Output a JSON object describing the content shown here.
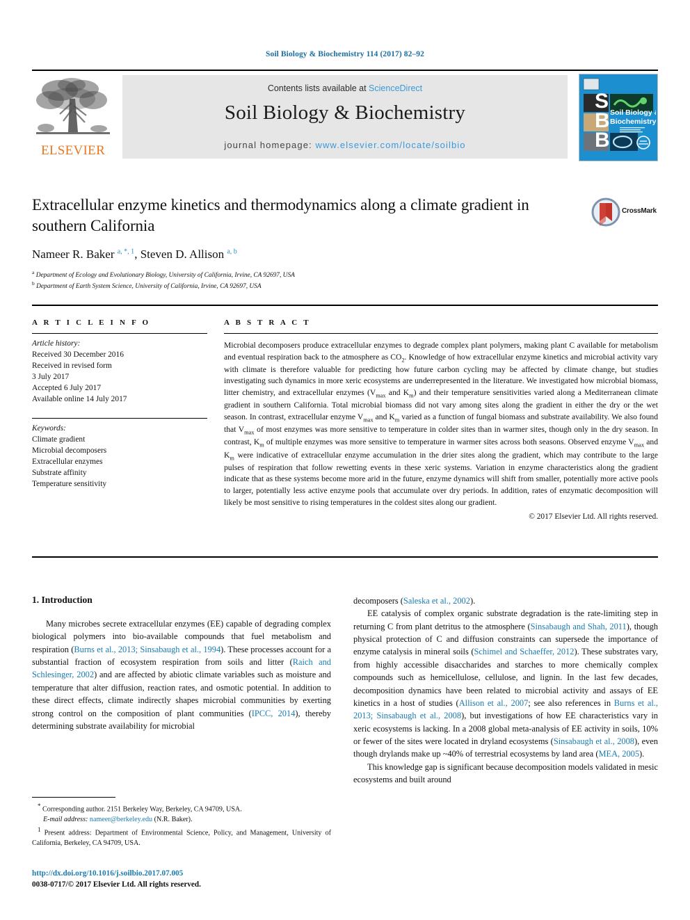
{
  "running_head": "Soil Biology & Biochemistry 114 (2017) 82–92",
  "masthead": {
    "contents_prefix": "Contents lists available at ",
    "sciencedirect": "ScienceDirect",
    "journal_title": "Soil Biology & Biochemistry",
    "homepage_prefix": "journal homepage: ",
    "homepage_url": "www.elsevier.com/locate/soilbio",
    "publisher_wordmark": "ELSEVIER",
    "publisher_logo_icon": "elsevier-tree-icon",
    "cover_icon": "journal-cover-thumbnail",
    "cover_letters": [
      "S",
      "B",
      "B"
    ],
    "cover_caption_line1": "Soil Biology &",
    "cover_caption_line2": "Biochemistry"
  },
  "article": {
    "title": "Extracellular enzyme kinetics and thermodynamics along a climate gradient in southern California",
    "authors_html": "Nameer R. Baker <sup>a, *, 1</sup>, Steven D. Allison <sup>a, b</sup>",
    "affiliation_a": "Department of Ecology and Evolutionary Biology, University of California, Irvine, CA 92697, USA",
    "affiliation_b": "Department of Earth System Science, University of California, Irvine, CA 92697, USA",
    "crossmark_label": "CrossMark",
    "crossmark_icon": "crossmark-icon"
  },
  "article_info": {
    "heading": "A R T I C L E    I N F O",
    "history_label": "Article history:",
    "history": [
      "Received 30 December 2016",
      "Received in revised form",
      "3 July 2017",
      "Accepted 6 July 2017",
      "Available online 14 July 2017"
    ],
    "keywords_label": "Keywords:",
    "keywords": [
      "Climate gradient",
      "Microbial decomposers",
      "Extracellular enzymes",
      "Substrate affinity",
      "Temperature sensitivity"
    ]
  },
  "abstract": {
    "heading": "A B S T R A C T",
    "body_html": "Microbial decomposers produce extracellular enzymes to degrade complex plant polymers, making plant C available for metabolism and eventual respiration back to the atmosphere as CO<sub>2</sub>. Knowledge of how extracellular enzyme kinetics and microbial activity vary with climate is therefore valuable for predicting how future carbon cycling may be affected by climate change, but studies investigating such dynamics in more xeric ecosystems are underrepresented in the literature. We investigated how microbial biomass, litter chemistry, and extracellular enzymes (V<sub>max</sub> and K<sub>m</sub>) and their temperature sensitivities varied along a Mediterranean climate gradient in southern California. Total microbial biomass did not vary among sites along the gradient in either the dry or the wet season. In contrast, extracellular enzyme V<sub>max</sub> and K<sub>m</sub> varied as a function of fungal biomass and substrate availability. We also found that V<sub>max</sub> of most enzymes was more sensitive to temperature in colder sites than in warmer sites, though only in the dry season. In contrast, K<sub>m</sub> of multiple enzymes was more sensitive to temperature in warmer sites across both seasons. Observed enzyme V<sub>max</sub> and K<sub>m</sub> were indicative of extracellular enzyme accumulation in the drier sites along the gradient, which may contribute to the large pulses of respiration that follow rewetting events in these xeric systems. Variation in enzyme characteristics along the gradient indicate that as these systems become more arid in the future, enzyme dynamics will shift from smaller, potentially more active pools to larger, potentially less active enzyme pools that accumulate over dry periods. In addition, rates of enzymatic decomposition will likely be most sensitive to rising temperatures in the coldest sites along our gradient.",
    "copyright": "© 2017 Elsevier Ltd. All rights reserved."
  },
  "body": {
    "section_heading": "1. Introduction",
    "left_paragraphs_html": [
      "Many microbes secrete extracellular enzymes (EE) capable of degrading complex biological polymers into bio-available compounds that fuel metabolism and respiration (<span class=\"ref\">Burns et al., 2013; Sinsabaugh et al., 1994</span>). These processes account for a substantial fraction of ecosystem respiration from soils and litter (<span class=\"ref\">Raich and Schlesinger, 2002</span>) and are affected by abiotic climate variables such as moisture and temperature that alter diffusion, reaction rates, and osmotic potential. In addition to these direct effects, climate indirectly shapes microbial communities by exerting strong control on the composition of plant communities (<span class=\"ref\">IPCC, 2014</span>), thereby determining substrate availability for microbial"
    ],
    "right_paragraphs_html": [
      "decomposers (<span class=\"ref\">Saleska et al., 2002</span>).",
      "EE catalysis of complex organic substrate degradation is the rate-limiting step in returning C from plant detritus to the atmosphere (<span class=\"ref\">Sinsabaugh and Shah, 2011</span>), though physical protection of C and diffusion constraints can supersede the importance of enzyme catalysis in mineral soils (<span class=\"ref\">Schimel and Schaeffer, 2012</span>). These substrates vary, from highly accessible disaccharides and starches to more chemically complex compounds such as hemicellulose, cellulose, and lignin. In the last few decades, decomposition dynamics have been related to microbial activity and assays of EE kinetics in a host of studies (<span class=\"ref\">Allison et al., 2007</span>; see also references in <span class=\"ref\">Burns et al., 2013; Sinsabaugh et al., 2008</span>), but investigations of how EE characteristics vary in xeric ecosystems is lacking. In a 2008 global meta-analysis of EE activity in soils, 10% or fewer of the sites were located in dryland ecosystems (<span class=\"ref\">Sinsabaugh et al., 2008</span>), even though drylands make up ~40% of terrestrial ecosystems by land area (<span class=\"ref\">MEA, 2005</span>).",
      "This knowledge gap is significant because decomposition models validated in mesic ecosystems and built around"
    ]
  },
  "footnotes": {
    "corresponding_html": "<span class=\"mark\">*</span> Corresponding author. 2151 Berkeley Way, Berkeley, CA 94709, USA.",
    "email_html": "<span class=\"em\">E-mail address:</span> <span class=\"mail\">nameer@berkeley.edu</span> (N.R. Baker).",
    "present_address_html": "<span class=\"mark\">1</span> Present address: Department of Environmental Science, Policy, and Management, University of California, Berkeley, CA 94709, USA."
  },
  "footer": {
    "doi": "http://dx.doi.org/10.1016/j.soilbio.2017.07.005",
    "issn_line": "0038-0717/© 2017 Elsevier Ltd. All rights reserved."
  },
  "colors": {
    "link_blue": "#1a7bb0",
    "sciencedirect_blue": "#3a9ad9",
    "elsevier_orange": "#E87722",
    "cover_blue": "#1b8fd0",
    "band_grey": "#e6e6e6"
  }
}
